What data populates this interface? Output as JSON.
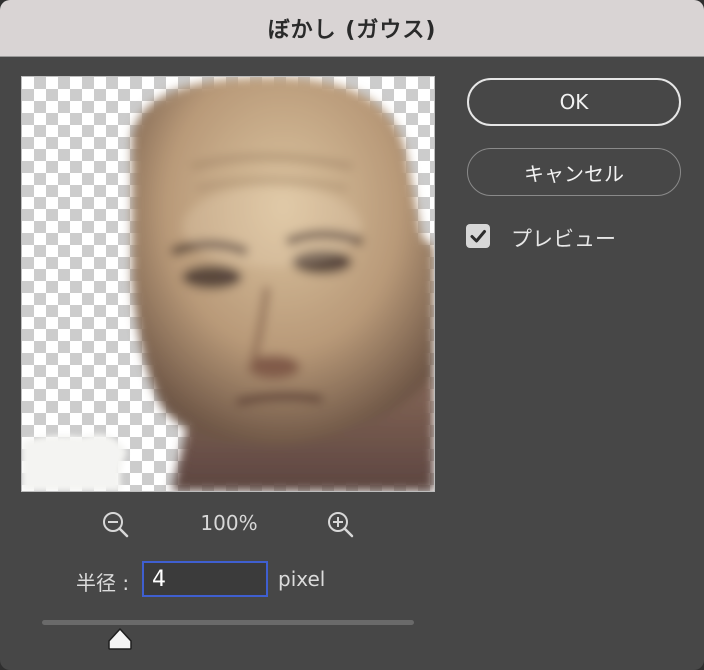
{
  "dialog": {
    "title": "ぼかし (ガウス)"
  },
  "buttons": {
    "ok_label": "OK",
    "cancel_label": "キャンセル"
  },
  "preview_option": {
    "label": "プレビュー",
    "checked": true
  },
  "zoom": {
    "level": "100%",
    "zoom_out_icon": "zoom-out-magnifier",
    "zoom_in_icon": "zoom-in-magnifier"
  },
  "radius": {
    "label": "半径 :",
    "value": "4",
    "unit": "pixel",
    "slider_fraction": 0.2
  },
  "colors": {
    "dialog_bg": "#474747",
    "titlebar_bg": "#d9d4d4",
    "input_focus_border": "#3f5fd0"
  }
}
